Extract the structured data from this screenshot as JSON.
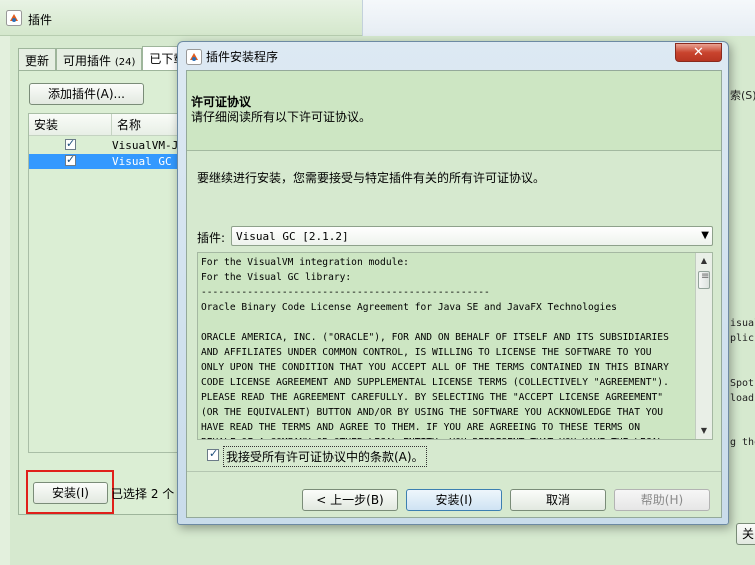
{
  "background_window": {
    "title": "插件",
    "tabs": [
      {
        "label": "更新"
      },
      {
        "label": "可用插件",
        "count": "(24)"
      },
      {
        "label": "已下载"
      }
    ],
    "add_plugin_button": "添加插件(A)...",
    "table": {
      "columns": [
        "安装",
        "名称"
      ],
      "rows": [
        {
          "checked": true,
          "name": "VisualVM-JConsole"
        },
        {
          "checked": true,
          "name": "Visual GC"
        }
      ]
    },
    "install_button": "安装(I)",
    "selected_status": "已选择 2 个",
    "right_fragments": [
      "索(S)",
      "isual",
      "plic",
      "Spot",
      "load",
      "g the"
    ],
    "right_button_fragment": "关"
  },
  "dialog": {
    "title": "插件安装程序",
    "close_glyph": "✕",
    "header": {
      "title": "许可证协议",
      "subtitle": "请仔细阅读所有以下许可证协议。"
    },
    "intro": "要继续进行安装，您需要接受与特定插件有关的所有许可证协议。",
    "plugin_label": "插件:",
    "plugin_selected": "Visual GC [2.1.2]",
    "license_text": "For the VisualVM integration module:\nFor the Visual GC library:\n--------------------------------------------------\nOracle Binary Code License Agreement for Java SE and JavaFX Technologies\n\nORACLE AMERICA, INC. (\"ORACLE\"), FOR AND ON BEHALF OF ITSELF AND ITS SUBSIDIARIES\nAND AFFILIATES UNDER COMMON CONTROL, IS WILLING TO LICENSE THE SOFTWARE TO YOU\nONLY UPON THE CONDITION THAT YOU ACCEPT ALL OF THE TERMS CONTAINED IN THIS BINARY\nCODE LICENSE AGREEMENT AND SUPPLEMENTAL LICENSE TERMS (COLLECTIVELY \"AGREEMENT\").\nPLEASE READ THE AGREEMENT CAREFULLY. BY SELECTING THE \"ACCEPT LICENSE AGREEMENT\"\n(OR THE EQUIVALENT) BUTTON AND/OR BY USING THE SOFTWARE YOU ACKNOWLEDGE THAT YOU\nHAVE READ THE TERMS AND AGREE TO THEM. IF YOU ARE AGREEING TO THESE TERMS ON\nBEHALF OF A COMPANY OR OTHER LEGAL ENTITY, YOU REPRESENT THAT YOU HAVE THE LEGAL",
    "accept_checkbox": {
      "checked": true,
      "label": "我接受所有许可证协议中的条款(A)。"
    },
    "buttons": {
      "back": "< 上一步(B)",
      "install": "安装(I)",
      "cancel": "取消",
      "help": "帮助(H)"
    }
  },
  "colors": {
    "panel_green": "#d6e9cf",
    "header_green": "#cde6c3",
    "selection_blue": "#3399ff",
    "highlight_red": "#e0201a"
  }
}
